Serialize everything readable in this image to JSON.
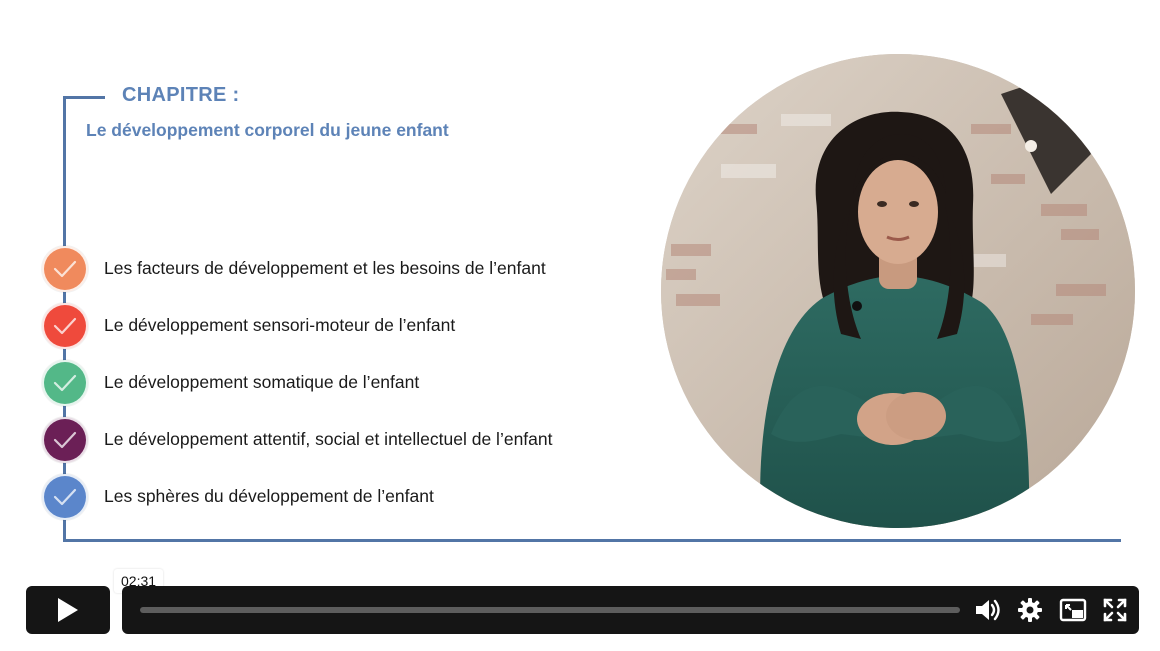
{
  "chapter": {
    "heading": "CHAPITRE :",
    "subtitle": "Le développement corporel du jeune enfant"
  },
  "items": [
    {
      "label": "Les facteurs de développement et les besoins de l’enfant",
      "color": "#f08a5d",
      "completed": true
    },
    {
      "label": "Le développement sensori-moteur de l’enfant",
      "color": "#ef4a3c",
      "completed": true
    },
    {
      "label": "Le développement somatique de l’enfant",
      "color": "#53b888",
      "completed": true
    },
    {
      "label": "Le développement attentif, social et intellectuel de l’enfant",
      "color": "#6b1f56",
      "completed": true
    },
    {
      "label": "Les sphères du développement de l’enfant",
      "color": "#5b86cb",
      "completed": true
    }
  ],
  "player": {
    "hover_time": "02:31",
    "progress": 0,
    "icons": {
      "play": "play-icon",
      "volume": "volume-icon",
      "settings": "gear-icon",
      "pip": "picture-in-picture-icon",
      "fullscreen": "fullscreen-icon"
    }
  },
  "colors": {
    "accent": "#5d83b7",
    "frame": "#5275a6",
    "controlbar": "#151515"
  }
}
